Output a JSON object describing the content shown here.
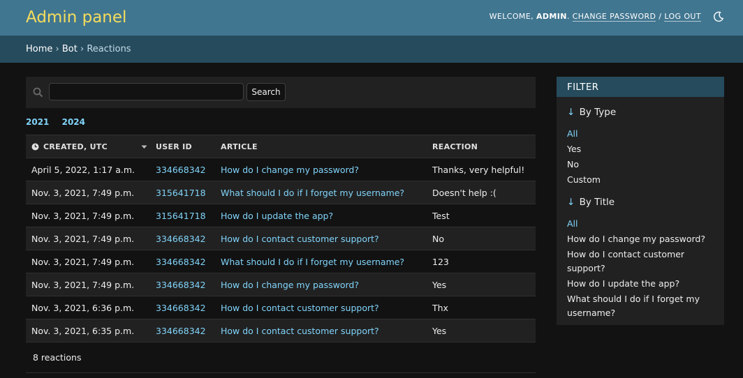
{
  "header": {
    "branding": "Admin panel",
    "welcome": "WELCOME,",
    "username": "ADMIN",
    "change_password": "CHANGE PASSWORD",
    "separator": "/",
    "logout": "LOG OUT",
    "theme_icon": "moon-icon"
  },
  "breadcrumbs": {
    "home": "Home",
    "app": "Bot",
    "current": "Reactions",
    "sep": "›"
  },
  "search": {
    "value": "",
    "placeholder": "",
    "button": "Search"
  },
  "date_hierarchy": [
    "2021",
    "2024"
  ],
  "table": {
    "headers": {
      "created": "CREATED, UTC",
      "user": "USER ID",
      "article": "ARTICLE",
      "reaction": "REACTION"
    },
    "rows": [
      {
        "created": "April 5, 2022, 1:17 a.m.",
        "user": "334668342",
        "article": "How do I change my password?",
        "reaction": "Thanks, very helpful!"
      },
      {
        "created": "Nov. 3, 2021, 7:49 p.m.",
        "user": "315641718",
        "article": "What should I do if I forget my username?",
        "reaction": "Doesn't help :("
      },
      {
        "created": "Nov. 3, 2021, 7:49 p.m.",
        "user": "315641718",
        "article": "How do I update the app?",
        "reaction": "Test"
      },
      {
        "created": "Nov. 3, 2021, 7:49 p.m.",
        "user": "334668342",
        "article": "How do I contact customer support?",
        "reaction": "No"
      },
      {
        "created": "Nov. 3, 2021, 7:49 p.m.",
        "user": "334668342",
        "article": "What should I do if I forget my username?",
        "reaction": "123"
      },
      {
        "created": "Nov. 3, 2021, 7:49 p.m.",
        "user": "334668342",
        "article": "How do I change my password?",
        "reaction": "Yes"
      },
      {
        "created": "Nov. 3, 2021, 6:36 p.m.",
        "user": "334668342",
        "article": "How do I contact customer support?",
        "reaction": "Thx"
      },
      {
        "created": "Nov. 3, 2021, 6:35 p.m.",
        "user": "334668342",
        "article": "How do I contact customer support?",
        "reaction": "Yes"
      }
    ]
  },
  "result_count": "8 reactions",
  "filter": {
    "title": "FILTER",
    "arrow": "↓",
    "type": {
      "heading": "By Type",
      "items": [
        "All",
        "Yes",
        "No",
        "Custom"
      ]
    },
    "title_filter": {
      "heading": "By Title",
      "items": [
        "All",
        "How do I change my password?",
        "How do I contact customer support?",
        "How do I update the app?",
        "What should I do if I forget my username?"
      ]
    }
  },
  "colors": {
    "header_bg": "#417690",
    "breadcrumb_bg": "#264b5d",
    "branding": "#f5dd5d",
    "link": "#81d4fa",
    "page_bg": "#121212"
  }
}
